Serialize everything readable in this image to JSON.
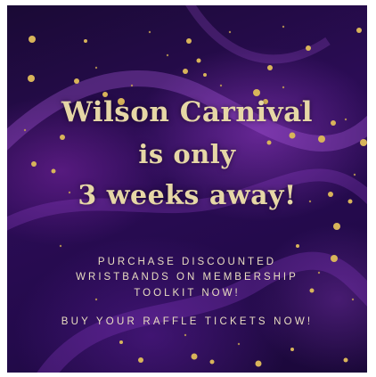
{
  "poster": {
    "headline_line1": "Wilson Carnival",
    "headline_line2": "is only",
    "headline_line3": "3 weeks away!",
    "cta_line1": "PURCHASE DISCOUNTED",
    "cta_line2": "WRISTBANDS ON MEMBERSHIP",
    "cta_line3": "TOOLKIT NOW!",
    "cta_line4": "BUY YOUR RAFFLE TICKETS NOW!"
  },
  "colors": {
    "background": "#230a4b",
    "accent_gold": "#e6d7a6",
    "text_cream": "#e8dcc0"
  }
}
